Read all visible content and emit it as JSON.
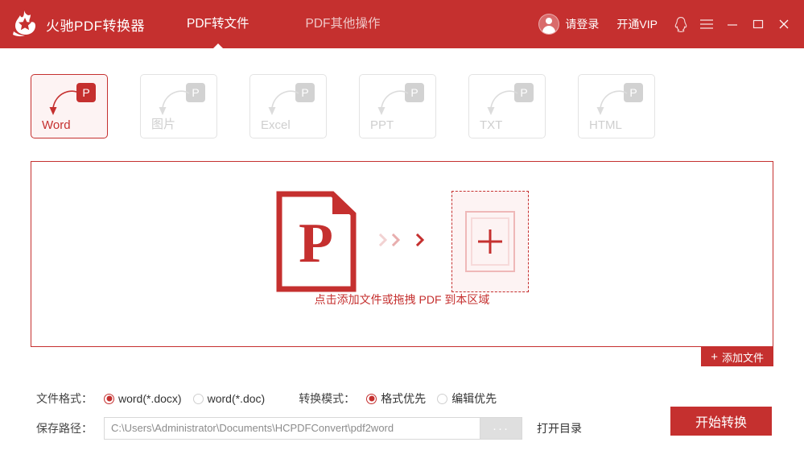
{
  "app": {
    "title": "火驰PDF转换器",
    "logo_icon": "flame-logo-icon",
    "accent_color": "#C5302F",
    "header_bg": "#C5302F"
  },
  "nav": {
    "items": [
      {
        "label": "PDF转文件",
        "active": true
      },
      {
        "label": "PDF其他操作",
        "active": false
      }
    ]
  },
  "account": {
    "avatar_icon": "user-avatar-icon",
    "login_label": "请登录",
    "vip_label": "开通VIP"
  },
  "window_controls": {
    "qq_icon": "qq-penguin-icon",
    "menu_icon": "hamburger-menu-icon",
    "minimize_icon": "minimize-icon",
    "maximize_icon": "maximize-icon",
    "close_icon": "close-icon"
  },
  "format_cards": {
    "badge_letter": "P",
    "items": [
      {
        "label": "Word",
        "active": true
      },
      {
        "label": "图片",
        "active": false
      },
      {
        "label": "Excel",
        "active": false
      },
      {
        "label": "PPT",
        "active": false
      },
      {
        "label": "TXT",
        "active": false
      },
      {
        "label": "HTML",
        "active": false
      }
    ]
  },
  "dropzone": {
    "pdf_letter": "P",
    "pdf_icon": "pdf-document-icon",
    "plus_icon": "add-plus-icon",
    "chevron_icon": "chevron-right-icon",
    "hint": "点击添加文件或拖拽 PDF 到本区域",
    "add_file_button": "添加文件",
    "add_file_plus": "+"
  },
  "options": {
    "file_format_label": "文件格式：",
    "file_format_options": [
      {
        "label": "word(*.docx)",
        "selected": true
      },
      {
        "label": "word(*.doc)",
        "selected": false
      }
    ],
    "convert_mode_label": "转换模式：",
    "convert_mode_options": [
      {
        "label": "格式优先",
        "selected": true
      },
      {
        "label": "编辑优先",
        "selected": false
      }
    ]
  },
  "save_path": {
    "label": "保存路径：",
    "value": "C:\\Users\\Administrator\\Documents\\HCPDFConvert\\pdf2word",
    "browse_label": "···",
    "open_dir_label": "打开目录"
  },
  "actions": {
    "start_label": "开始转换"
  }
}
